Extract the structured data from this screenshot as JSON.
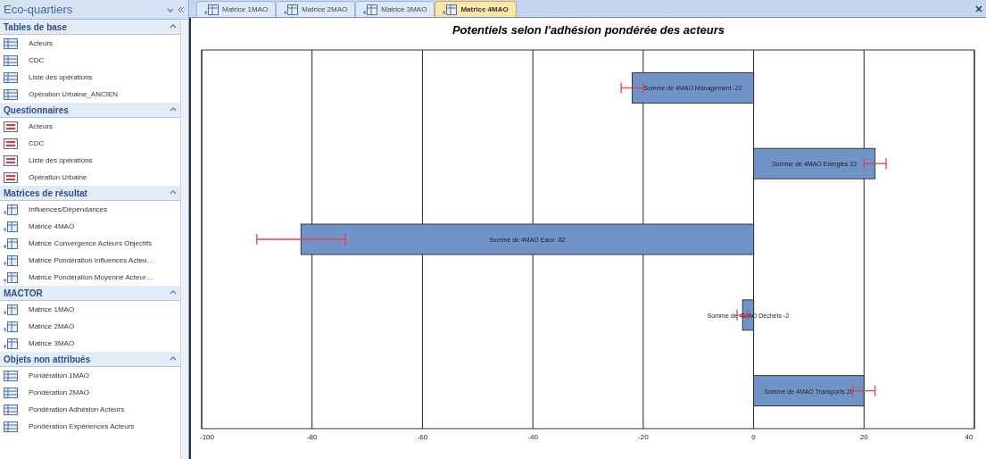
{
  "nav_pane": {
    "title": "Eco-quartiers",
    "groups": [
      {
        "label": "Tables de base",
        "expanded": true,
        "items": [
          {
            "label": "Acteurs",
            "kind": "table"
          },
          {
            "label": "CDC",
            "kind": "table"
          },
          {
            "label": "Liste des opérations",
            "kind": "table"
          },
          {
            "label": "Opération Urbaine_ANCIEN",
            "kind": "table"
          }
        ]
      },
      {
        "label": "Questionnaires",
        "expanded": true,
        "items": [
          {
            "label": "Acteurs",
            "kind": "form"
          },
          {
            "label": "CDC",
            "kind": "form"
          },
          {
            "label": "Liste des opérations",
            "kind": "form"
          },
          {
            "label": "Opération Urbaine",
            "kind": "form"
          }
        ]
      },
      {
        "label": "Matrices de résultat",
        "expanded": true,
        "items": [
          {
            "label": "Influences/Dépendances",
            "kind": "query"
          },
          {
            "label": "Matrice 4MAO",
            "kind": "query"
          },
          {
            "label": "Matrice Convergence Acteurs Objectifs",
            "kind": "query"
          },
          {
            "label": "Matrice Pondération Influences Acteu…",
            "kind": "query"
          },
          {
            "label": "Matrice Pondération Moyenne Acteur…",
            "kind": "query"
          }
        ]
      },
      {
        "label": "MACTOR",
        "expanded": true,
        "items": [
          {
            "label": "Matrice 1MAO",
            "kind": "query"
          },
          {
            "label": "Matrice 2MAO",
            "kind": "query"
          },
          {
            "label": "Matrice 3MAO",
            "kind": "query"
          }
        ]
      },
      {
        "label": "Objets non attribués",
        "expanded": true,
        "items": [
          {
            "label": "Pondération 1MAO",
            "kind": "table"
          },
          {
            "label": "Pondération 2MAO",
            "kind": "table"
          },
          {
            "label": "Pondération Adhésion Acteurs",
            "kind": "table"
          },
          {
            "label": "Pondération Expériences Acteurs",
            "kind": "table"
          }
        ]
      }
    ]
  },
  "tabs": [
    {
      "label": "Matrice 1MAO",
      "selected": false
    },
    {
      "label": "Matrice 2MAO",
      "selected": false
    },
    {
      "label": "Matrice 3MAO",
      "selected": false
    },
    {
      "label": "Matrice 4MAO",
      "selected": true
    }
  ],
  "chart": {
    "chart_data": {
      "type": "bar",
      "orientation": "horizontal",
      "title": "Potentiels selon l'adhésion pondérée des acteurs",
      "series": [
        {
          "color": "#7094c8",
          "values": [
            -22,
            22,
            -82,
            -2,
            20
          ],
          "errors": [
            [
              -24,
              -20
            ],
            [
              20,
              24
            ],
            [
              -90,
              -74
            ],
            [
              -3,
              -1
            ],
            [
              18,
              22
            ]
          ]
        }
      ],
      "xlim": [
        -100,
        40
      ],
      "xticks": [
        -100,
        -80,
        -60,
        -40,
        -20,
        0,
        20,
        40
      ],
      "grid": true,
      "value_labels": [
        "Somme de 4MAO Management -22",
        "Somme de 4MAO Energies 22",
        "Somme de 4MAO Eaux -82",
        "Somme de 4MAO Déchets -2",
        "Somme de 4MAO Transports 20"
      ]
    }
  }
}
